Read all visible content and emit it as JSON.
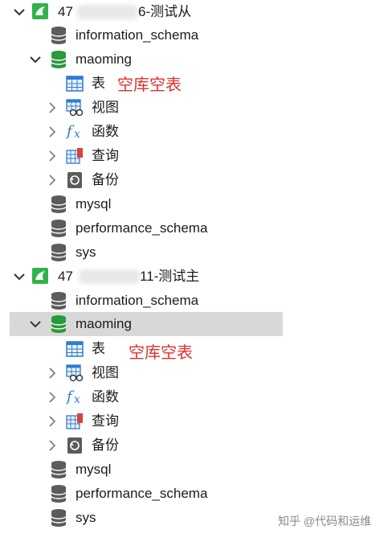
{
  "colors": {
    "selected_row_bg": "#d8d8d8",
    "annotation_red": "#e03030",
    "connection_green": "#2fb34a",
    "db_gray": "#5c5c5c",
    "db_green": "#2a9a3c"
  },
  "connections": [
    {
      "name_prefix": "47",
      "name_suffix": "6-测试从",
      "expanded": true,
      "databases": [
        {
          "label": "information_schema"
        },
        {
          "label": "maoming",
          "expanded": true,
          "selected": false,
          "children": {
            "tables": "表",
            "views": "视图",
            "functions": "函数",
            "queries": "查询",
            "backups": "备份"
          }
        },
        {
          "label": "mysql"
        },
        {
          "label": "performance_schema"
        },
        {
          "label": "sys"
        }
      ]
    },
    {
      "name_prefix": "47",
      "name_suffix": "11-测试主",
      "expanded": true,
      "databases": [
        {
          "label": "information_schema"
        },
        {
          "label": "maoming",
          "expanded": true,
          "selected": true,
          "children": {
            "tables": "表",
            "views": "视图",
            "functions": "函数",
            "queries": "查询",
            "backups": "备份"
          }
        },
        {
          "label": "mysql"
        },
        {
          "label": "performance_schema"
        },
        {
          "label": "sys"
        }
      ]
    }
  ],
  "annotations": [
    "空库空表",
    "空库空表"
  ],
  "watermark": "知乎 @代码和运维"
}
